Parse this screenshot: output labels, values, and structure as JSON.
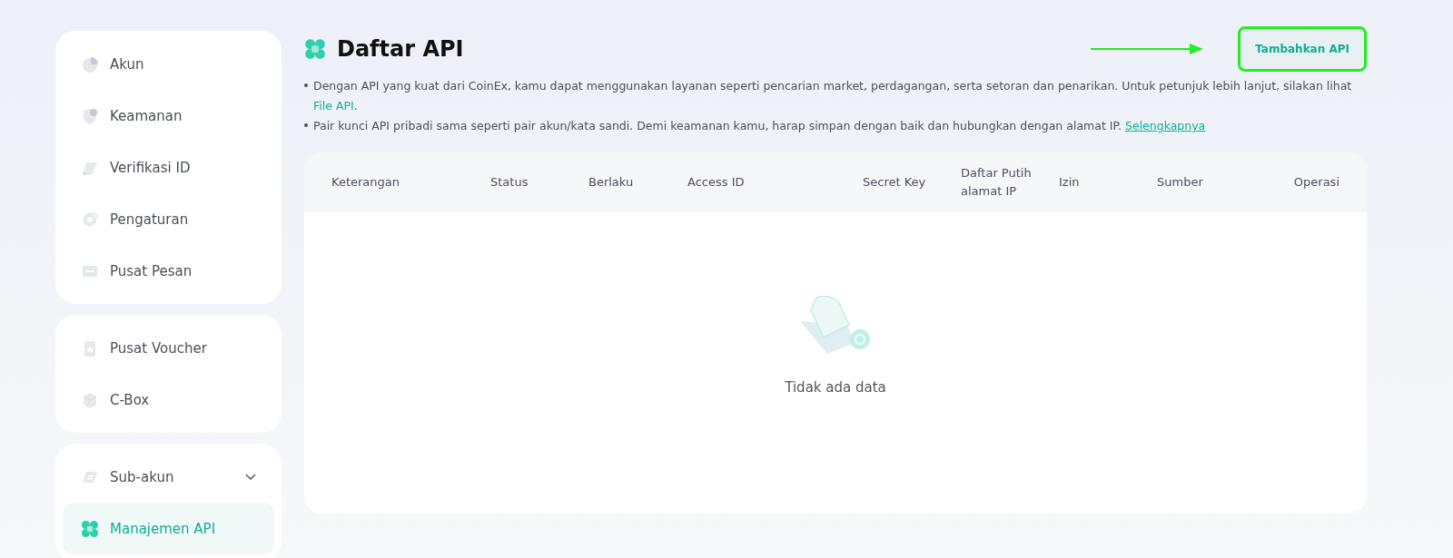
{
  "sidebar": {
    "groups": [
      {
        "items": [
          {
            "label": "Akun",
            "selected": false
          },
          {
            "label": "Keamanan",
            "selected": false
          },
          {
            "label": "Verifikasi ID",
            "selected": false
          },
          {
            "label": "Pengaturan",
            "selected": false
          },
          {
            "label": "Pusat Pesan",
            "selected": false
          }
        ]
      },
      {
        "items": [
          {
            "label": "Pusat Voucher",
            "selected": false
          },
          {
            "label": "C-Box",
            "selected": false
          }
        ]
      },
      {
        "items": [
          {
            "label": "Sub-akun",
            "selected": false,
            "expanded": true
          },
          {
            "label": "Manajemen API",
            "selected": true
          }
        ]
      }
    ]
  },
  "header": {
    "title": "Daftar API",
    "button": "Tambahkan API",
    "highlighted": true
  },
  "notes": [
    {
      "text": "Dengan API yang kuat dari CoinEx, kamu dapat menggunakan layanan seperti pencarian market, perdagangan, serta setoran dan penarikan. Untuk petunjuk lebih lanjut, silakan lihat",
      "link": "File API",
      "underlined": false,
      "after": "."
    },
    {
      "text": "Pair kunci API pribadi sama seperti pair akun/kata sandi. Demi keamanan kamu, harap simpan dengan baik dan hubungkan dengan alamat IP.",
      "link": "Selengkapnya",
      "underlined": true
    }
  ],
  "table": {
    "columns": [
      "Keterangan",
      "Status",
      "Berlaku",
      "Access ID",
      "Secret Key",
      "Daftar Putih alamat IP",
      "Izin",
      "Sumber",
      "Operasi"
    ],
    "empty": "Tidak ada data"
  }
}
